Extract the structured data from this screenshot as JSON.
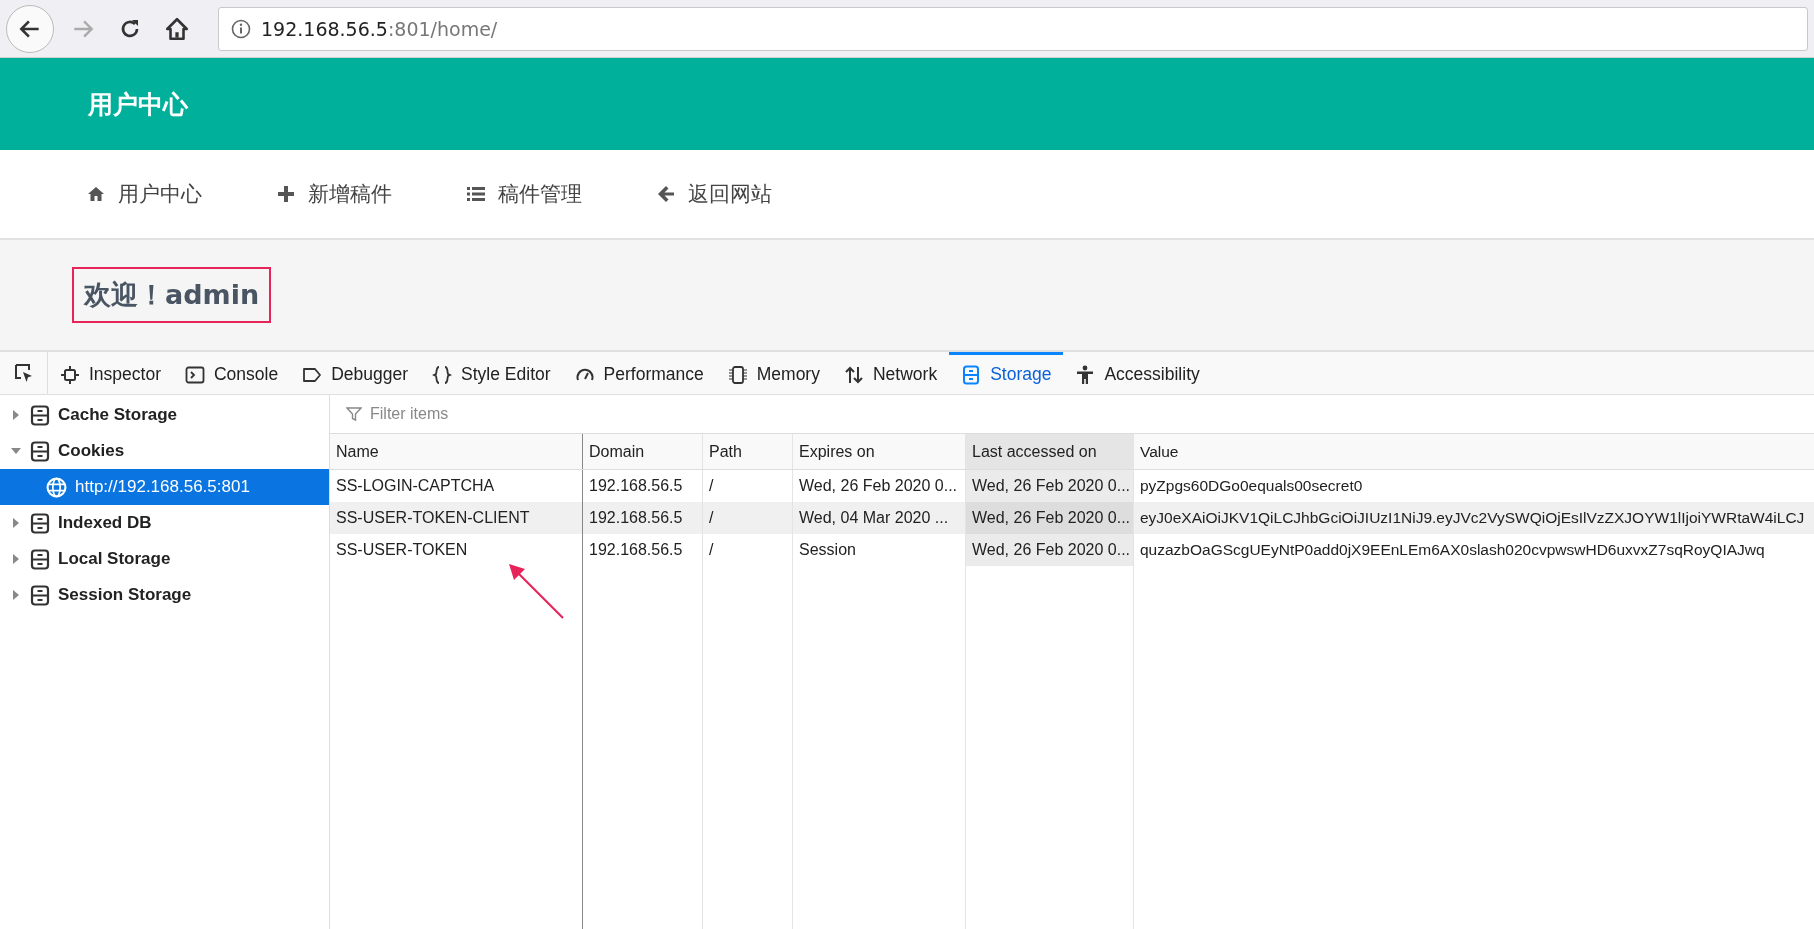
{
  "browser": {
    "url_host": "192.168.56.5",
    "url_rest": ":801/home/",
    "forward_disabled": true
  },
  "site": {
    "title": "用户中心",
    "nav": [
      {
        "label": "用户中心"
      },
      {
        "label": "新增稿件"
      },
      {
        "label": "稿件管理"
      },
      {
        "label": "返回网站"
      }
    ],
    "welcome": "欢迎！admin"
  },
  "devtools": {
    "tabs": [
      {
        "label": "Inspector",
        "selected": false
      },
      {
        "label": "Console",
        "selected": false
      },
      {
        "label": "Debugger",
        "selected": false
      },
      {
        "label": "Style Editor",
        "selected": false
      },
      {
        "label": "Performance",
        "selected": false
      },
      {
        "label": "Memory",
        "selected": false
      },
      {
        "label": "Network",
        "selected": false
      },
      {
        "label": "Storage",
        "selected": true
      },
      {
        "label": "Accessibility",
        "selected": false
      }
    ],
    "sidebar": {
      "items": [
        {
          "label": "Cache Storage",
          "expanded": false,
          "selected": false
        },
        {
          "label": "Cookies",
          "expanded": true,
          "selected": false,
          "children": [
            {
              "label": "http://192.168.56.5:801",
              "selected": true
            }
          ]
        },
        {
          "label": "Indexed DB",
          "expanded": false,
          "selected": false
        },
        {
          "label": "Local Storage",
          "expanded": false,
          "selected": false
        },
        {
          "label": "Session Storage",
          "expanded": false,
          "selected": false
        }
      ]
    },
    "filter": {
      "placeholder": "Filter items"
    },
    "table": {
      "columns": [
        {
          "label": "Name",
          "sorted": false
        },
        {
          "label": "Domain",
          "sorted": false
        },
        {
          "label": "Path",
          "sorted": false
        },
        {
          "label": "Expires on",
          "sorted": false
        },
        {
          "label": "Last accessed on",
          "sorted": true
        },
        {
          "label": "Value",
          "sorted": false
        }
      ],
      "rows": [
        {
          "cells": [
            "SS-LOGIN-CAPTCHA",
            "192.168.56.5",
            "/",
            "Wed, 26 Feb 2020 0...",
            "Wed, 26 Feb 2020 0...",
            "pyZpgs60DGo0equals00secret0"
          ],
          "selected": false
        },
        {
          "cells": [
            "SS-USER-TOKEN-CLIENT",
            "192.168.56.5",
            "/",
            "Wed, 04 Mar 2020 ...",
            "Wed, 26 Feb 2020 0...",
            "eyJ0eXAiOiJKV1QiLCJhbGciOiJIUzI1NiJ9.eyJVc2VySWQiOjEsIlVzZXJOYW1lIjoiYWRtaW4iLCJ"
          ],
          "selected": true
        },
        {
          "cells": [
            "SS-USER-TOKEN",
            "192.168.56.5",
            "/",
            "Session",
            "Wed, 26 Feb 2020 0...",
            "quzazbOaGScgUEyNtP0add0jX9EEnLEm6AX0slash020cvpwswHD6uxvxZ7sqRoyQIAJwq"
          ],
          "selected": false
        }
      ]
    }
  }
}
